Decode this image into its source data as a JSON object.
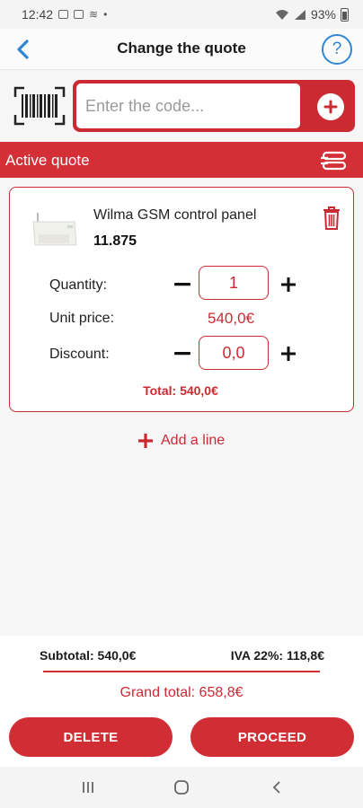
{
  "status": {
    "time": "12:42",
    "battery": "93%"
  },
  "header": {
    "title": "Change the quote",
    "help": "?"
  },
  "code": {
    "placeholder": "Enter the code..."
  },
  "active": {
    "label": "Active quote"
  },
  "item": {
    "name": "Wilma GSM control panel",
    "code": "11.875",
    "quantity_label": "Quantity:",
    "quantity_value": "1",
    "unit_price_label": "Unit price:",
    "unit_price_value": "540,0€",
    "discount_label": "Discount:",
    "discount_value": "0,0",
    "total": "Total: 540,0€"
  },
  "add_line": {
    "label": "Add a line"
  },
  "summary": {
    "subtotal": "Subtotal: 540,0€",
    "tax": "IVA 22%: 118,8€",
    "grand_total": "Grand total: 658,8€"
  },
  "actions": {
    "delete_label": "DELETE",
    "proceed_label": "PROCEED"
  },
  "colors": {
    "accent": "#d42e37",
    "link": "#2f86d3"
  },
  "icons": [
    "back-chevron-icon",
    "help-icon",
    "barcode-scan-icon",
    "plus-circle-icon",
    "list-toggle-icon",
    "trash-icon",
    "minus-icon",
    "plus-icon"
  ]
}
